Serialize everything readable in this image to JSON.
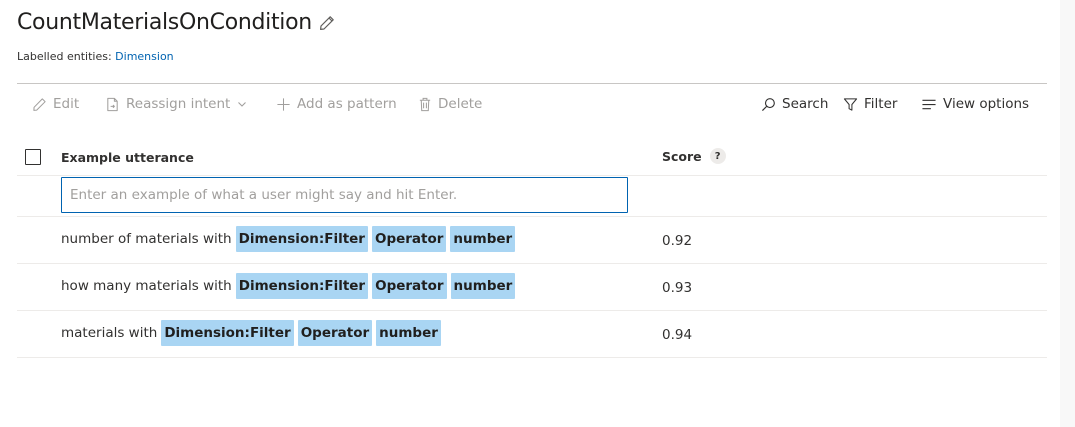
{
  "intent": {
    "title": "CountMaterialsOnCondition",
    "labelled_prefix": "Labelled entities:",
    "labelled_entity": "Dimension"
  },
  "toolbar": {
    "edit": "Edit",
    "reassign": "Reassign intent",
    "add_pattern": "Add as pattern",
    "delete": "Delete",
    "search": "Search",
    "filter": "Filter",
    "view_options": "View options"
  },
  "table": {
    "col_utterance": "Example utterance",
    "col_score": "Score",
    "help_glyph": "?",
    "input_placeholder": "Enter an example of what a user might say and hit Enter.",
    "input_value": "",
    "rows": [
      {
        "text": "number of materials with",
        "entities": [
          "Dimension:Filter",
          "Operator",
          "number"
        ],
        "score": "0.92"
      },
      {
        "text": "how many materials with",
        "entities": [
          "Dimension:Filter",
          "Operator",
          "number"
        ],
        "score": "0.93"
      },
      {
        "text": "materials with",
        "entities": [
          "Dimension:Filter",
          "Operator",
          "number"
        ],
        "score": "0.94"
      }
    ]
  },
  "colors": {
    "link": "#0063b1",
    "entity_chip": "#a9d5f3",
    "input_border": "#0063b1",
    "disabled_text": "#a19f9d"
  },
  "icons": [
    "pencil-icon",
    "edit-icon",
    "reassign-icon",
    "chevron-down-icon",
    "plus-icon",
    "trash-icon",
    "search-icon",
    "filter-icon",
    "view-options-icon",
    "help-icon"
  ]
}
